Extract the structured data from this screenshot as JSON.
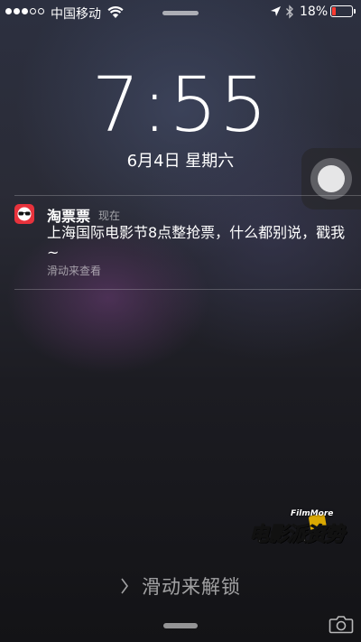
{
  "status_bar": {
    "signal_filled": 3,
    "signal_total": 5,
    "carrier": "中国移动",
    "wifi_icon": "wifi-icon",
    "location_icon": "location-arrow-icon",
    "bluetooth_icon": "bluetooth-icon",
    "battery_percent": "18%",
    "battery_level": 0.18,
    "battery_color": "#ff3b30"
  },
  "lock_screen": {
    "time": "7:55",
    "date": "6月4日 星期六"
  },
  "assistive_touch": {
    "icon": "assistive-touch-icon"
  },
  "notification": {
    "app_icon": "taopiaopiao-app-icon",
    "app_icon_color": "#e8323c",
    "app_name": "淘票票",
    "time": "现在",
    "body": "上海国际电影节8点整抢票，什么都别说，戳我~",
    "hint": "滑动来查看"
  },
  "watermark": {
    "text_en": "FilmMore",
    "text_cn": "电影派资势"
  },
  "bottom": {
    "slide_to_unlock": "滑动来解锁",
    "chevron_icon": "chevron-right-icon",
    "camera_icon": "camera-icon"
  }
}
